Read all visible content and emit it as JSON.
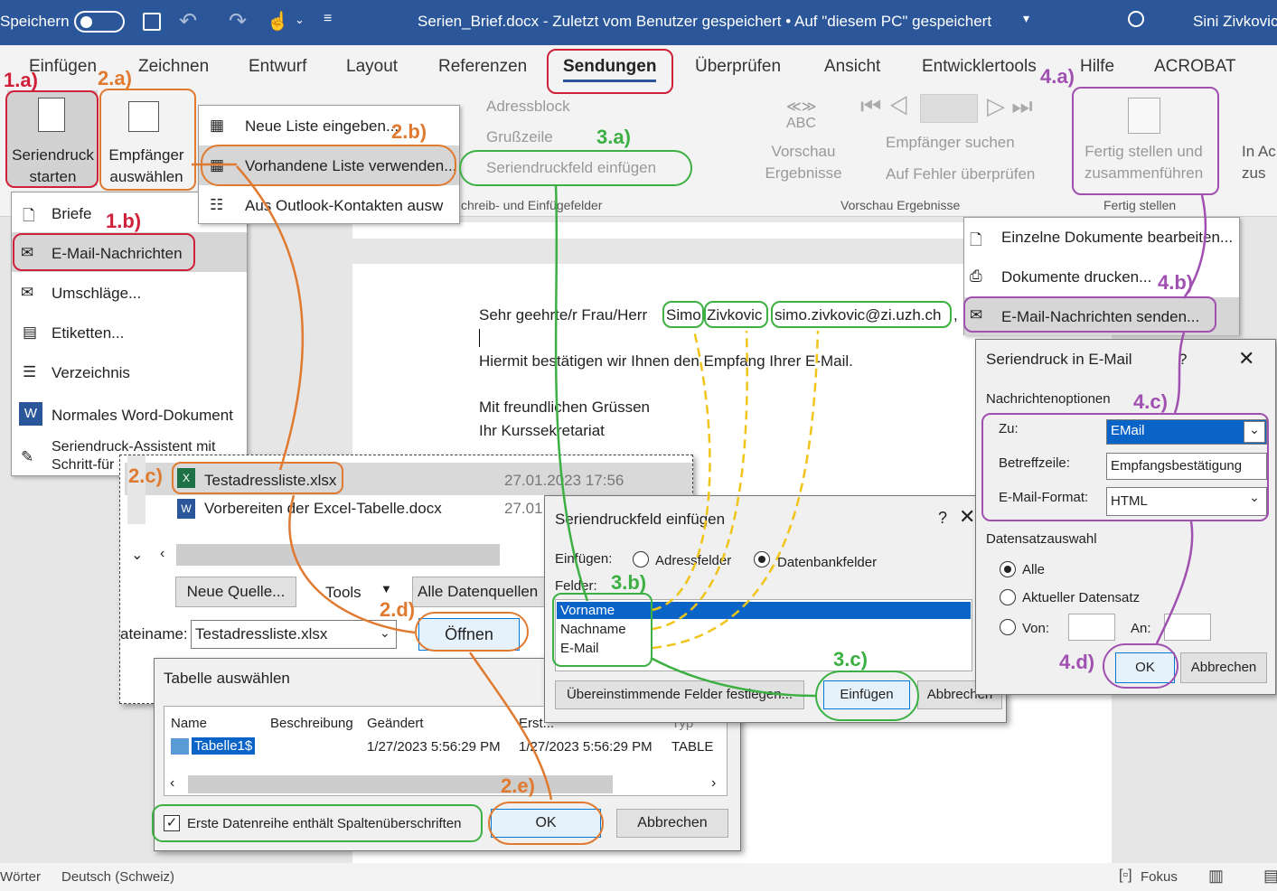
{
  "titlebar": {
    "autosave_label": "Speichern",
    "title": "Serien_Brief.docx  -  Zuletzt vom Benutzer gespeichert • Auf \"diesem PC\" gespeichert",
    "user": "Sini Zivkovic"
  },
  "tabs": [
    "Einfügen",
    "Zeichnen",
    "Entwurf",
    "Layout",
    "Referenzen",
    "Sendungen",
    "Überprüfen",
    "Ansicht",
    "Entwicklertools",
    "Hilfe",
    "ACROBAT"
  ],
  "ribbon": {
    "seriendruck_starten": "Seriendruck starten",
    "empfaenger_auswaehlen": "Empfänger auswählen",
    "adressblock": "Adressblock",
    "grusszeile": "Grußzeile",
    "seriendruckfeld_einfuegen": "Seriendruckfeld einfügen",
    "schreib_group": "chreib- und Einfügefelder",
    "vorschau": "Vorschau Ergebnisse",
    "vorschau_group": "Vorschau Ergebnisse",
    "empfaenger_suchen": "Empfänger suchen",
    "auf_fehler": "Auf Fehler überprüfen",
    "fertig_stellen": "Fertig stellen und zusammenführen",
    "fertig_group": "Fertig stellen",
    "in_acrobat": "In Ac zus"
  },
  "start_menu": [
    "Briefe",
    "E-Mail-Nachrichten",
    "Umschläge...",
    "Etiketten...",
    "Verzeichnis",
    "Normales Word-Dokument",
    "Seriendruck-Assistent mit Schritt-für"
  ],
  "recipients_menu": [
    "Neue Liste eingeben...",
    "Vorhandene Liste verwenden...",
    "Aus Outlook-Kontakten ausw"
  ],
  "finish_menu": [
    "Einzelne Dokumente bearbeiten...",
    "Dokumente drucken...",
    "E-Mail-Nachrichten senden..."
  ],
  "document": {
    "line1_prefix": "Sehr geehrte/r Frau/Herr",
    "field_first": "Simo",
    "field_last": "Zivkovic",
    "field_email": "simo.zivkovic@zi.uzh.ch",
    "line1_suffix": ",",
    "line2": "Hiermit bestätigen wir Ihnen den Empfang Ihrer E-Mail.",
    "line3": "Mit freundlichen Grüssen",
    "line4": "Ihr Kurssekretariat"
  },
  "file_dialog": {
    "files": [
      {
        "name": "Testadressliste.xlsx",
        "date": "27.01.2023 17:56"
      },
      {
        "name": "Vorbereiten der Excel-Tabelle.docx",
        "date": "27.01"
      }
    ],
    "new_source": "Neue Quelle...",
    "tools": "Tools",
    "filter": "Alle Datenquellen",
    "filename_label": "ateiname:",
    "filename_value": "Testadressliste.xlsx",
    "open": "Öffnen"
  },
  "table_dialog": {
    "title": "Tabelle auswählen",
    "columns": [
      "Name",
      "Beschreibung",
      "Geändert",
      "Erst...",
      "Typ"
    ],
    "row": [
      "Tabelle1$",
      "",
      "1/27/2023 5:56:29 PM",
      "1/27/2023 5:56:29 PM",
      "TABLE"
    ],
    "checkbox": "Erste Datenreihe enthält Spaltenüberschriften",
    "ok": "OK",
    "cancel": "Abbrechen"
  },
  "field_dialog": {
    "title": "Seriendruckfeld einfügen",
    "help": "?",
    "insert_label": "Einfügen:",
    "radio_address": "Adressfelder",
    "radio_db": "Datenbankfelder",
    "fields_label": "Felder:",
    "fields": [
      "Vorname",
      "Nachname",
      "E-Mail"
    ],
    "match": "Übereinstimmende Felder festlegen...",
    "insert": "Einfügen",
    "cancel": "Abbrechen"
  },
  "email_dialog": {
    "title": "Seriendruck in E-Mail",
    "help": "?",
    "options": "Nachrichtenoptionen",
    "to_label": "Zu:",
    "to_value": "EMail",
    "subject_label": "Betreffzeile:",
    "subject_value": "Empfangsbestätigung",
    "format_label": "E-Mail-Format:",
    "format_value": "HTML",
    "records": "Datensatzauswahl",
    "all": "Alle",
    "current": "Aktueller Datensatz",
    "from": "Von:",
    "to": "An:",
    "ok": "OK",
    "cancel": "Abbrechen"
  },
  "annotations": [
    "1.a)",
    "2.a)",
    "1.b)",
    "2.b)",
    "2.c)",
    "2.d)",
    "2.e)",
    "3.a)",
    "3.b)",
    "3.c)",
    "4.a)",
    "4.b)",
    "4.c)",
    "4.d)"
  ],
  "statusbar": {
    "words": "Wörter",
    "language": "Deutsch (Schweiz)",
    "focus": "Fokus"
  },
  "colors": {
    "title_bg": "#2b579a",
    "red": "#d0213a",
    "orange": "#e07a30",
    "green": "#3cb043",
    "yellow": "#f0c419",
    "purple": "#a050b0",
    "select": "#0a64c8"
  }
}
